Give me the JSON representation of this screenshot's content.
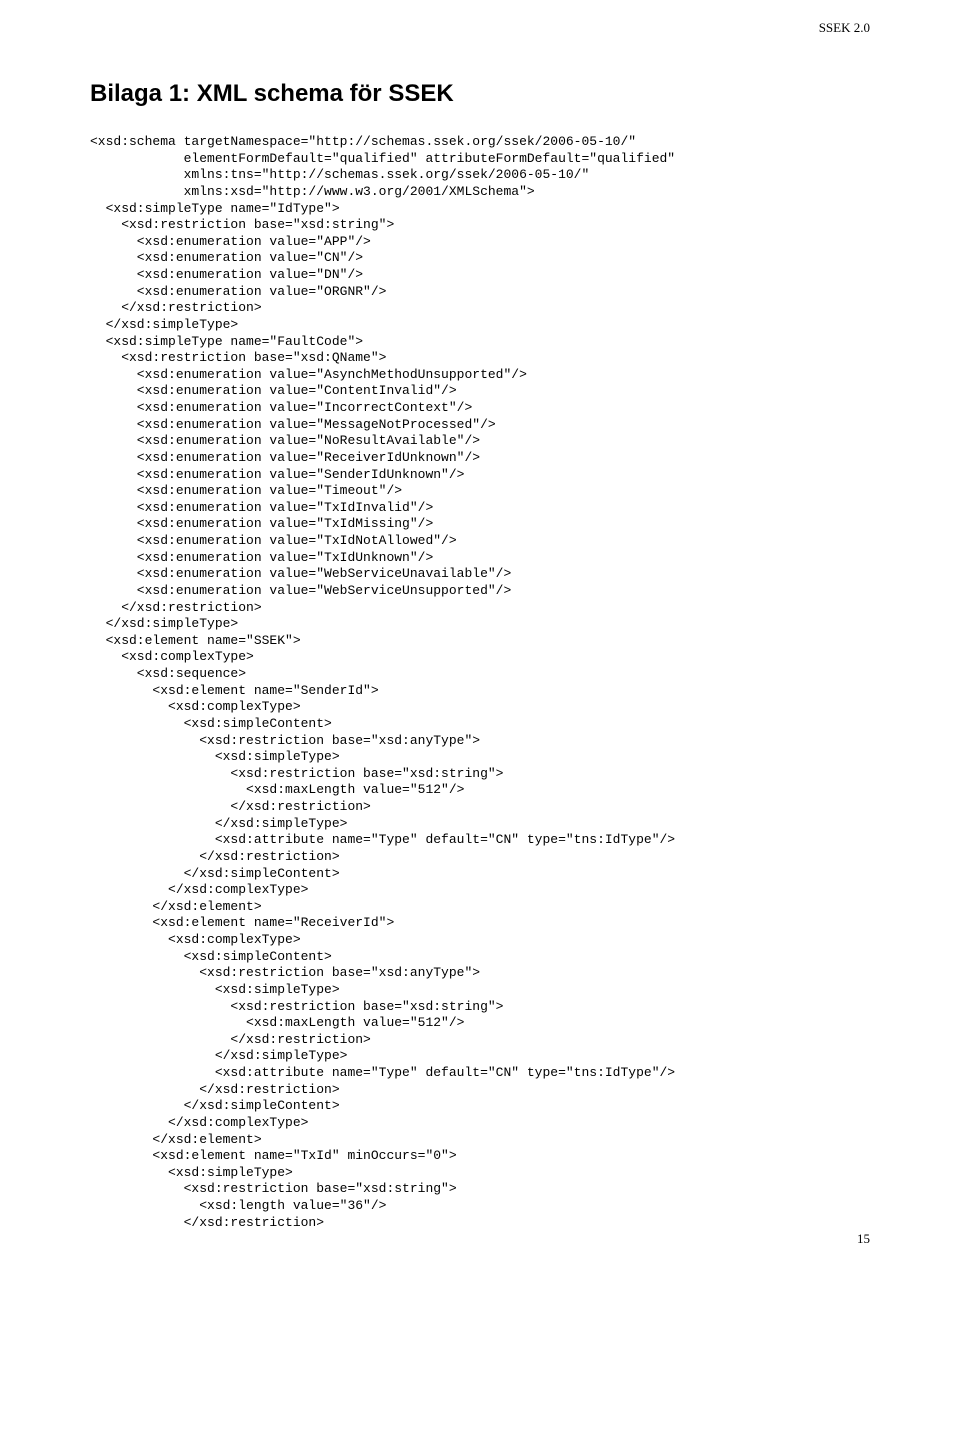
{
  "header": {
    "docLabel": "SSEK 2.0"
  },
  "title": "Bilaga 1: XML schema för SSEK",
  "code": "<xsd:schema targetNamespace=\"http://schemas.ssek.org/ssek/2006-05-10/\"\n            elementFormDefault=\"qualified\" attributeFormDefault=\"qualified\"\n            xmlns:tns=\"http://schemas.ssek.org/ssek/2006-05-10/\"\n            xmlns:xsd=\"http://www.w3.org/2001/XMLSchema\">\n  <xsd:simpleType name=\"IdType\">\n    <xsd:restriction base=\"xsd:string\">\n      <xsd:enumeration value=\"APP\"/>\n      <xsd:enumeration value=\"CN\"/>\n      <xsd:enumeration value=\"DN\"/>\n      <xsd:enumeration value=\"ORGNR\"/>\n    </xsd:restriction>\n  </xsd:simpleType>\n  <xsd:simpleType name=\"FaultCode\">\n    <xsd:restriction base=\"xsd:QName\">\n      <xsd:enumeration value=\"AsynchMethodUnsupported\"/>\n      <xsd:enumeration value=\"ContentInvalid\"/>\n      <xsd:enumeration value=\"IncorrectContext\"/>\n      <xsd:enumeration value=\"MessageNotProcessed\"/>\n      <xsd:enumeration value=\"NoResultAvailable\"/>\n      <xsd:enumeration value=\"ReceiverIdUnknown\"/>\n      <xsd:enumeration value=\"SenderIdUnknown\"/>\n      <xsd:enumeration value=\"Timeout\"/>\n      <xsd:enumeration value=\"TxIdInvalid\"/>\n      <xsd:enumeration value=\"TxIdMissing\"/>\n      <xsd:enumeration value=\"TxIdNotAllowed\"/>\n      <xsd:enumeration value=\"TxIdUnknown\"/>\n      <xsd:enumeration value=\"WebServiceUnavailable\"/>\n      <xsd:enumeration value=\"WebServiceUnsupported\"/>\n    </xsd:restriction>\n  </xsd:simpleType>\n  <xsd:element name=\"SSEK\">\n    <xsd:complexType>\n      <xsd:sequence>\n        <xsd:element name=\"SenderId\">\n          <xsd:complexType>\n            <xsd:simpleContent>\n              <xsd:restriction base=\"xsd:anyType\">\n                <xsd:simpleType>\n                  <xsd:restriction base=\"xsd:string\">\n                    <xsd:maxLength value=\"512\"/>\n                  </xsd:restriction>\n                </xsd:simpleType>\n                <xsd:attribute name=\"Type\" default=\"CN\" type=\"tns:IdType\"/>\n              </xsd:restriction>\n            </xsd:simpleContent>\n          </xsd:complexType>\n        </xsd:element>\n        <xsd:element name=\"ReceiverId\">\n          <xsd:complexType>\n            <xsd:simpleContent>\n              <xsd:restriction base=\"xsd:anyType\">\n                <xsd:simpleType>\n                  <xsd:restriction base=\"xsd:string\">\n                    <xsd:maxLength value=\"512\"/>\n                  </xsd:restriction>\n                </xsd:simpleType>\n                <xsd:attribute name=\"Type\" default=\"CN\" type=\"tns:IdType\"/>\n              </xsd:restriction>\n            </xsd:simpleContent>\n          </xsd:complexType>\n        </xsd:element>\n        <xsd:element name=\"TxId\" minOccurs=\"0\">\n          <xsd:simpleType>\n            <xsd:restriction base=\"xsd:string\">\n              <xsd:length value=\"36\"/>\n            </xsd:restriction>",
  "pageNumber": "15"
}
